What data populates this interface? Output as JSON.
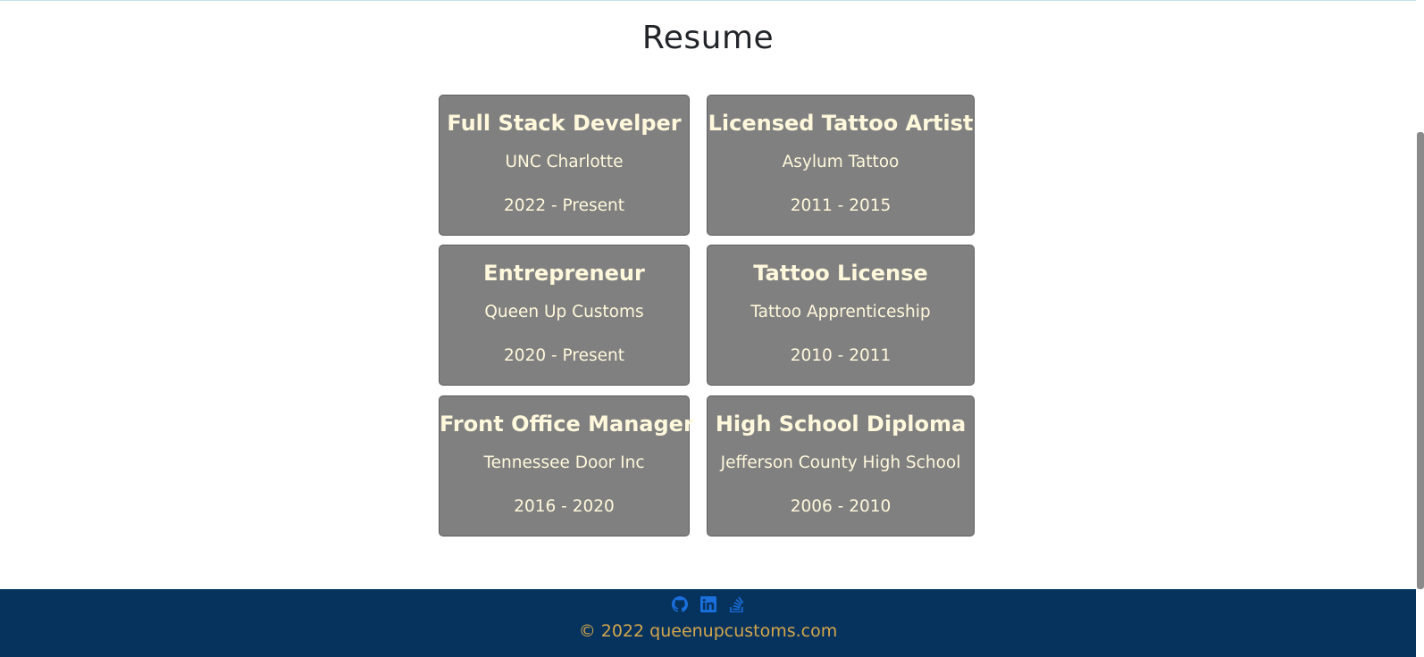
{
  "page": {
    "title": "Resume"
  },
  "cards": [
    {
      "title": "Full Stack Develper",
      "org": "UNC Charlotte",
      "dates": "2022 - Present"
    },
    {
      "title": "Licensed Tattoo Artist",
      "org": "Asylum Tattoo",
      "dates": "2011 - 2015"
    },
    {
      "title": "Entrepreneur",
      "org": "Queen Up Customs",
      "dates": "2020 - Present"
    },
    {
      "title": "Tattoo License",
      "org": "Tattoo Apprenticeship",
      "dates": "2010 - 2011"
    },
    {
      "title": "Front Office Manager",
      "org": "Tennessee Door Inc",
      "dates": "2016 - 2020"
    },
    {
      "title": "High School Diploma",
      "org": "Jefferson County High School",
      "dates": "2006 - 2010"
    }
  ],
  "footer": {
    "icons": [
      "github-icon",
      "linkedin-icon",
      "stack-overflow-icon"
    ],
    "copyright": "© 2022 queenupcustoms.com"
  },
  "colors": {
    "card_bg": "#808080",
    "card_text": "#fff8dc",
    "footer_bg": "#06335e",
    "footer_text": "#d4a64a",
    "icon_color": "#1a6fdc"
  }
}
